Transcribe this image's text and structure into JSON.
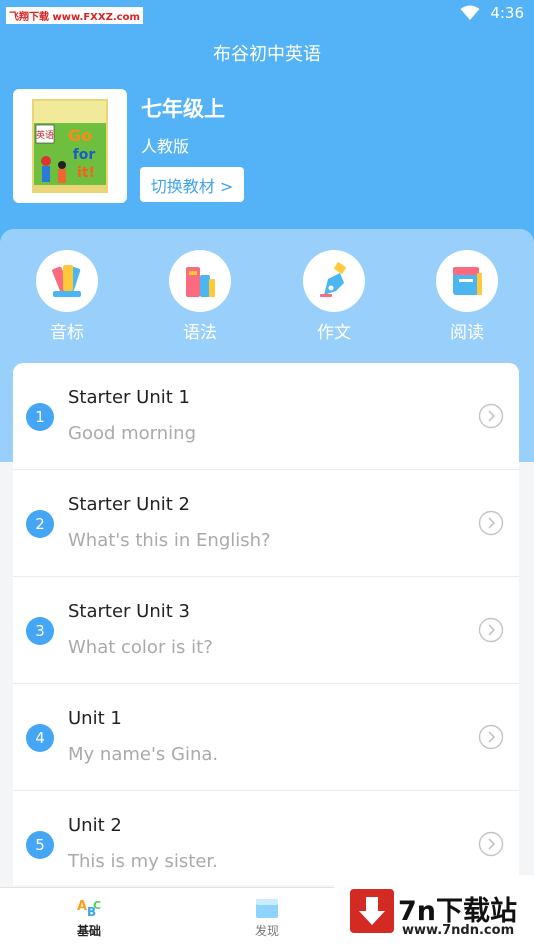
{
  "status": {
    "watermark": "飞翔下载 www.FXXZ.com",
    "time": "4:36"
  },
  "app": {
    "title": "布谷初中英语"
  },
  "book": {
    "grade": "七年级上",
    "edition": "人教版",
    "switch_label": "切换教材 >"
  },
  "categories": [
    {
      "label": "音标",
      "icon": "pencils-icon"
    },
    {
      "label": "语法",
      "icon": "books-icon"
    },
    {
      "label": "作文",
      "icon": "pen-nib-icon"
    },
    {
      "label": "阅读",
      "icon": "notebook-icon"
    }
  ],
  "units": [
    {
      "num": "1",
      "title": "Starter Unit 1",
      "subtitle": "Good morning"
    },
    {
      "num": "2",
      "title": "Starter Unit 2",
      "subtitle": "What's this in English?"
    },
    {
      "num": "3",
      "title": "Starter Unit 3",
      "subtitle": "What color is it?"
    },
    {
      "num": "4",
      "title": "Unit 1",
      "subtitle": "My name's Gina."
    },
    {
      "num": "5",
      "title": "Unit 2",
      "subtitle": "This is my sister."
    }
  ],
  "nav": {
    "home_label": "基础",
    "find_label": "发现"
  },
  "ad": {
    "name": "7n下载站",
    "url": "www.7ndn.com"
  },
  "colors": {
    "header": "#54b3f6",
    "panel": "#99d0fb",
    "accent": "#44a6f4"
  }
}
